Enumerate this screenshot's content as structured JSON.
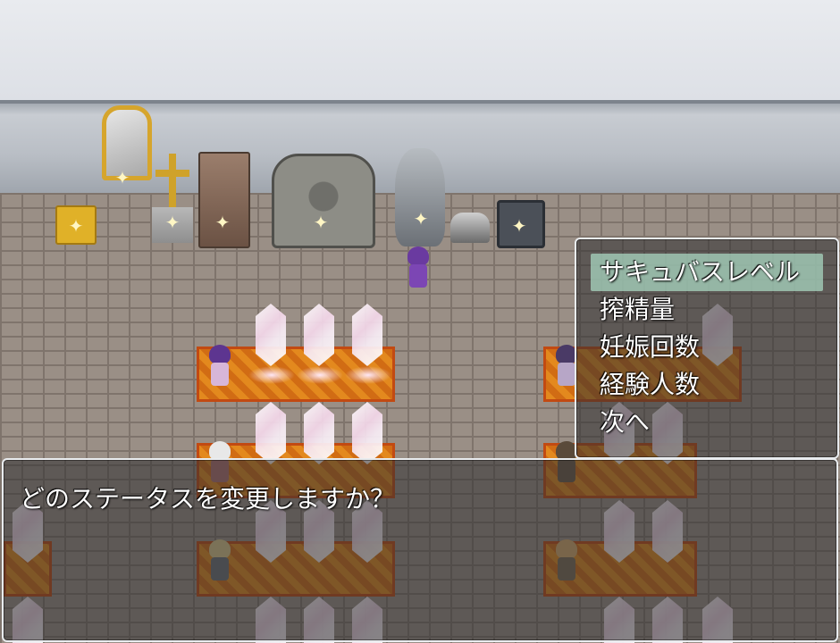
{
  "choice_menu": {
    "items": [
      {
        "label": "サキュバスレベル",
        "selected": true
      },
      {
        "label": "搾精量",
        "selected": false
      },
      {
        "label": "妊娠回数",
        "selected": false
      },
      {
        "label": "経験人数",
        "selected": false
      },
      {
        "label": "次へ",
        "selected": false
      }
    ]
  },
  "message": {
    "text": "どのステータスを変更しますか？"
  },
  "colors": {
    "selection_highlight": "#a8d6c0",
    "window_border": "#e9ecef",
    "window_fill": "#2d2d30",
    "carpet": "#e3891e",
    "floor": "#9a8f86"
  }
}
